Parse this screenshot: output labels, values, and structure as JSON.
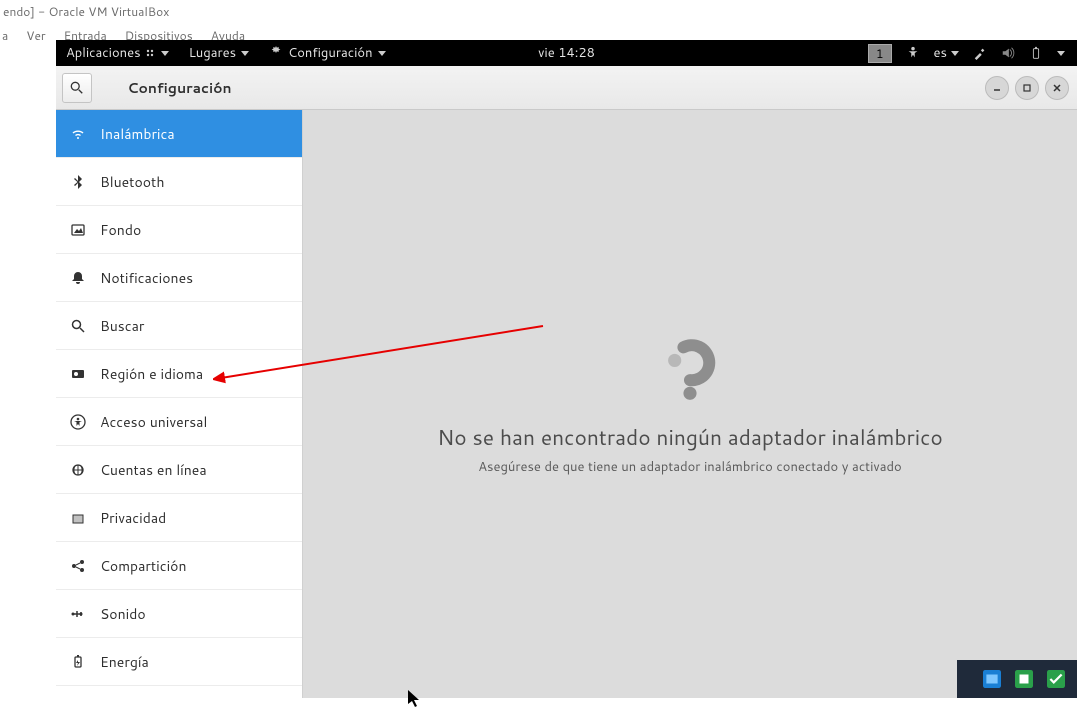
{
  "vbox": {
    "title": "endo] - Oracle VM VirtualBox",
    "menu": [
      "a",
      "Ver",
      "Entrada",
      "Dispositivos",
      "Ayuda"
    ]
  },
  "topbar": {
    "applications": "Aplicaciones",
    "places": "Lugares",
    "config": "Configuración",
    "clock": "vie 14:28",
    "workspace": "1",
    "keyboard": "es"
  },
  "headerbar": {
    "title": "Configuración"
  },
  "sidebar": {
    "items": [
      {
        "label": "Inalámbrica",
        "icon": "wifi",
        "active": true
      },
      {
        "label": "Bluetooth",
        "icon": "bluetooth"
      },
      {
        "label": "Fondo",
        "icon": "background"
      },
      {
        "label": "Notificaciones",
        "icon": "bell"
      },
      {
        "label": "Buscar",
        "icon": "search"
      },
      {
        "label": "Región e idioma",
        "icon": "region"
      },
      {
        "label": "Acceso universal",
        "icon": "accessibility"
      },
      {
        "label": "Cuentas en línea",
        "icon": "online"
      },
      {
        "label": "Privacidad",
        "icon": "privacy"
      },
      {
        "label": "Compartición",
        "icon": "share"
      },
      {
        "label": "Sonido",
        "icon": "sound"
      },
      {
        "label": "Energía",
        "icon": "power"
      }
    ]
  },
  "content": {
    "title": "No se han encontrado ningún adaptador inalámbrico",
    "subtitle": "Asegúrese de que tiene un adaptador inalámbrico conectado y activado"
  }
}
